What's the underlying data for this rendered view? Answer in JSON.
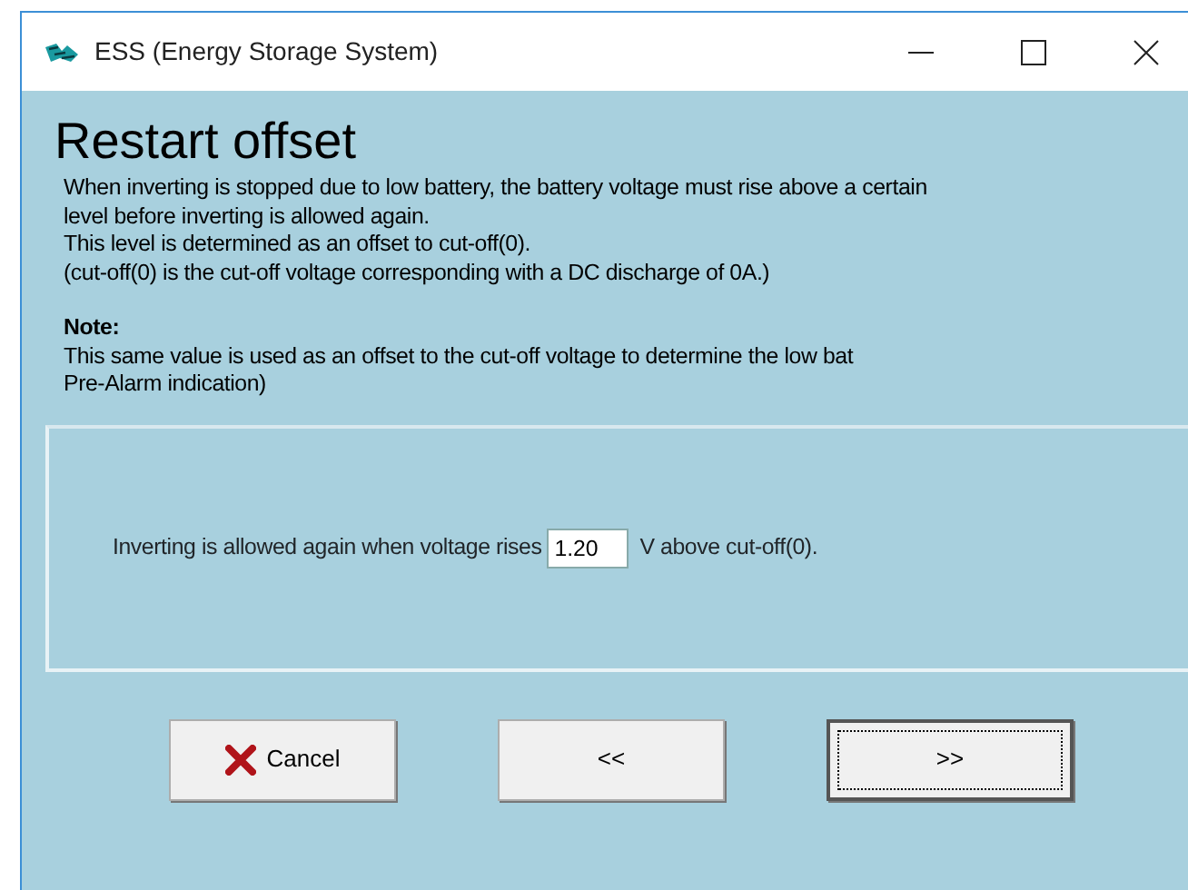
{
  "window": {
    "title": "ESS (Energy Storage System)"
  },
  "heading": "Restart offset",
  "description": [
    "When inverting is stopped due to low battery, the battery voltage must rise above a certain",
    "level before inverting is allowed again.",
    "This level is determined as an offset to cut-off(0).",
    "(cut-off(0) is the cut-off voltage corresponding with a DC discharge of 0A.)"
  ],
  "note": {
    "label": "Note:",
    "lines": [
      "This same value is used as an offset to the cut-off voltage to determine the low bat",
      "Pre-Alarm indication)"
    ]
  },
  "setting": {
    "prefix": "Inverting is allowed again when voltage rises",
    "value": "1.20",
    "suffix": "V above cut-off(0)."
  },
  "buttons": [
    {
      "kind": "cancel",
      "label": "Cancel",
      "focused": false
    },
    {
      "kind": "back",
      "label": "<<",
      "focused": false
    },
    {
      "kind": "next",
      "label": ">>",
      "focused": true
    }
  ]
}
